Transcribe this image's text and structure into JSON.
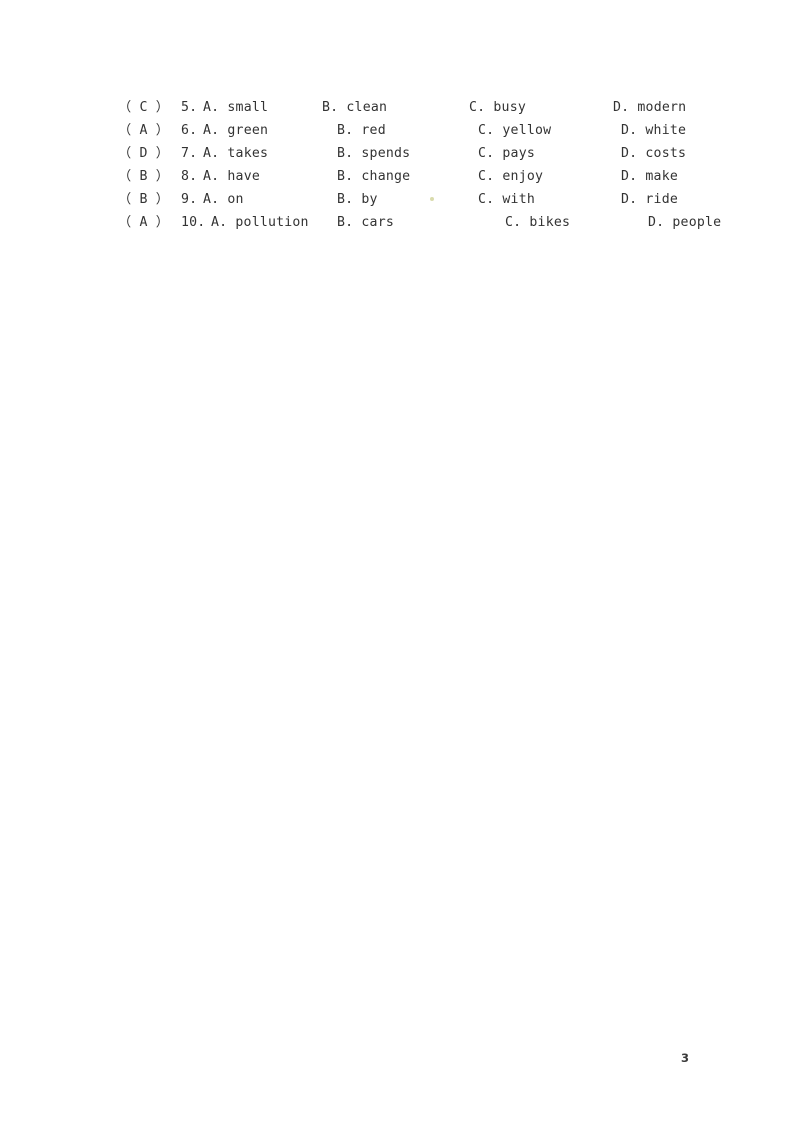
{
  "document": {
    "page_number": "3",
    "text_color": "#333333",
    "background_color": "#ffffff"
  },
  "questions": [
    {
      "marker": "（ C ）",
      "answer": "C",
      "number": "5.",
      "prompt": "5.",
      "options": {
        "a": "A. small",
        "b": "B. clean",
        "c": "C. busy",
        "d": "D. modern"
      }
    },
    {
      "marker": "（ A ）",
      "answer": "A",
      "number": "6.",
      "prompt": "6.",
      "options": {
        "a": "A. green",
        "b": "B. red",
        "c": "C. yellow",
        "d": "D. white"
      }
    },
    {
      "marker": "（ D ）",
      "answer": "D",
      "number": "7.",
      "prompt": "7.",
      "options": {
        "a": "A. takes",
        "b": "B. spends",
        "c": "C. pays",
        "d": "D. costs"
      }
    },
    {
      "marker": "（ B ）",
      "answer": "B",
      "number": "8.",
      "prompt": "8.",
      "options": {
        "a": "A. have",
        "b": "B. change",
        "c": "C. enjoy",
        "d": "D. make"
      }
    },
    {
      "marker": "（ B ）",
      "answer": "B",
      "number": "9.",
      "prompt": "9.",
      "options": {
        "a": "A. on",
        "b": "B. by",
        "c": "C. with",
        "d": "D. ride"
      }
    },
    {
      "marker": "（ A ）",
      "answer": "A",
      "number": "10.",
      "prompt": "10.",
      "options": {
        "a": "A. pollution",
        "b": "B. cars",
        "c": "C. bikes",
        "d": "D. people"
      }
    }
  ]
}
